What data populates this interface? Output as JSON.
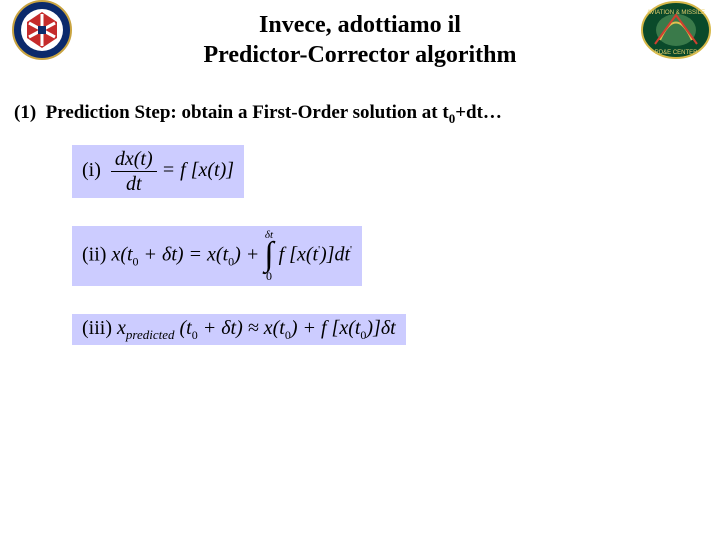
{
  "title_line1": "Invece, adottiamo il",
  "title_line2": "Predictor-Corrector algorithm",
  "step_label_prefix": "(1)",
  "step_text_a": "Prediction Step: obtain a First-Order solution at t",
  "step_sub": "0",
  "step_text_b": "+",
  "step_delta": "d",
  "step_text_c": "t…",
  "eq1_label": "(i)",
  "eq1_num": "dx(t)",
  "eq1_den": "dt",
  "eq1_rhs": " = f [x(t)]",
  "eq2_label": "(ii)",
  "eq2_lhs_a": " x(t",
  "eq2_lhs_b": " + ",
  "eq2_lhs_c": "t) = x(t",
  "eq2_lhs_d": ") + ",
  "eq2_int_top": "δt",
  "eq2_int_sym": "∫",
  "eq2_int_bot": "0",
  "eq2_rhs_a": " f [x(t",
  "eq2_rhs_b": ")]dt",
  "eq3_label": "(iii)",
  "eq3_a": " x",
  "eq3_pred": "predicted",
  "eq3_b": " (t",
  "eq3_c": " + ",
  "eq3_d": "t) ≈ x(t",
  "eq3_e": ") + f [x(t",
  "eq3_f": ")]",
  "eq3_g": "t",
  "zero": "0",
  "prime": "'",
  "delta_it": "δ"
}
